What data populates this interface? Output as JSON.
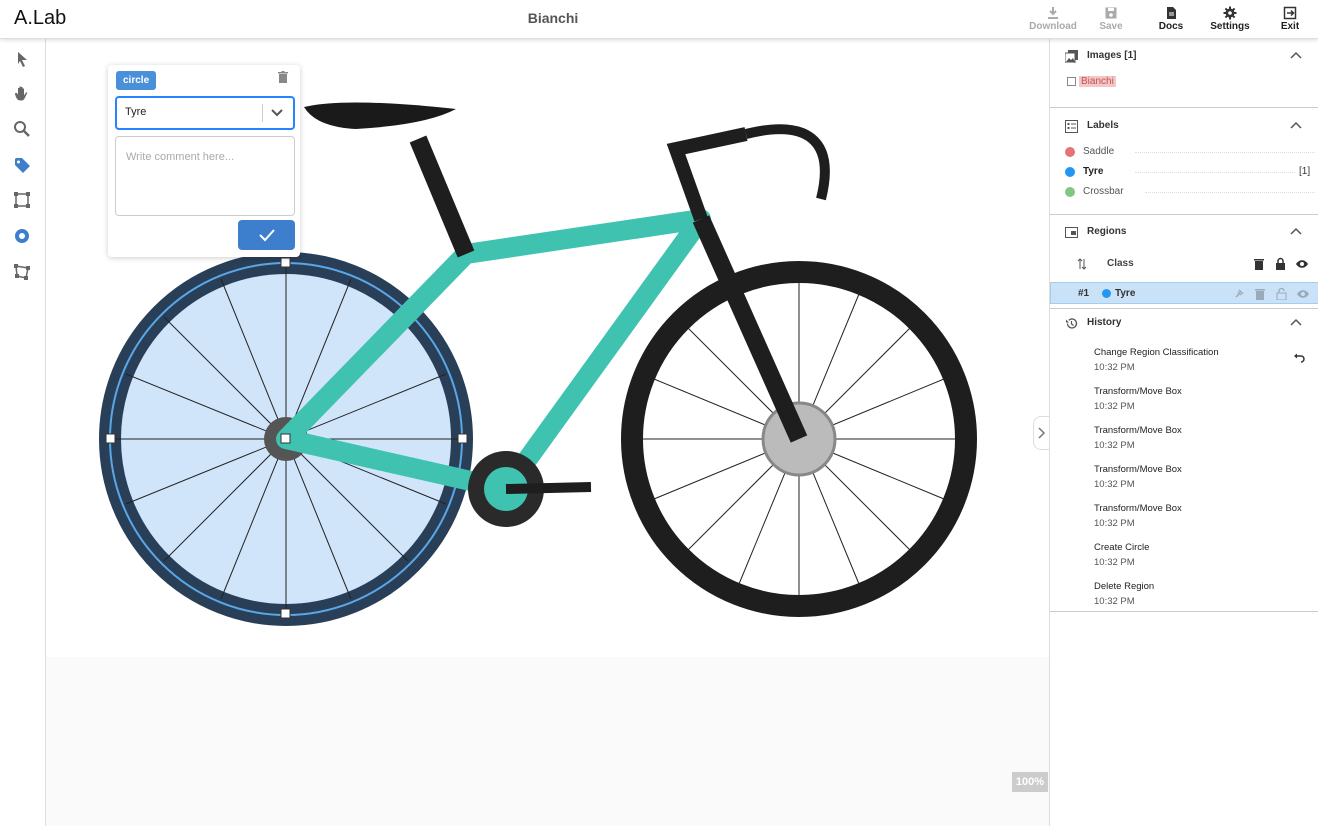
{
  "app": {
    "brand": "A.Lab",
    "title": "Bianchi"
  },
  "header": {
    "download": "Download",
    "save": "Save",
    "docs": "Docs",
    "settings": "Settings",
    "exit": "Exit"
  },
  "canvas": {
    "zoom": "100%"
  },
  "editor": {
    "region_type": "circle",
    "selected_class": "Tyre",
    "comment_placeholder": "Write comment here..."
  },
  "images_panel": {
    "title": "Images [1]",
    "items": [
      {
        "name": "Bianchi"
      }
    ]
  },
  "labels_panel": {
    "title": "Labels",
    "items": [
      {
        "name": "Saddle",
        "color": "#e57373",
        "count": ""
      },
      {
        "name": "Tyre",
        "color": "#2196f3",
        "count": "[1]"
      },
      {
        "name": "Crossbar",
        "color": "#81c784",
        "count": ""
      }
    ]
  },
  "regions_panel": {
    "title": "Regions",
    "column_class": "Class",
    "rows": [
      {
        "id": "#1",
        "class": "Tyre",
        "color": "#2196f3"
      }
    ]
  },
  "history_panel": {
    "title": "History",
    "items": [
      {
        "action": "Change Region Classification",
        "time": "10:32 PM"
      },
      {
        "action": "Transform/Move Box",
        "time": "10:32 PM"
      },
      {
        "action": "Transform/Move Box",
        "time": "10:32 PM"
      },
      {
        "action": "Transform/Move Box",
        "time": "10:32 PM"
      },
      {
        "action": "Transform/Move Box",
        "time": "10:32 PM"
      },
      {
        "action": "Create Circle",
        "time": "10:32 PM"
      },
      {
        "action": "Delete Region",
        "time": "10:32 PM"
      }
    ]
  },
  "colors": {
    "accent": "#3d7fcc",
    "region_fill": "#c9e2f7",
    "bike_body": "#3fc3b0"
  }
}
